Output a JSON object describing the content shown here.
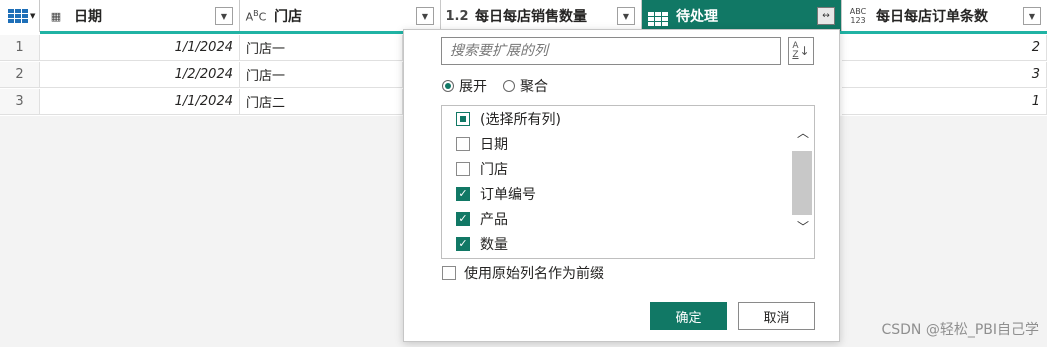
{
  "table": {
    "columns": [
      {
        "type_icon": "calendar-icon",
        "label": "日期"
      },
      {
        "type_icon": "ABC",
        "label": "门店"
      },
      {
        "type_icon": "1.2",
        "label": "每日每店销售数量"
      },
      {
        "type_icon": "table-icon",
        "label": "待处理"
      },
      {
        "type_icon": "ABC 123",
        "label": "每日每店订单条数"
      }
    ],
    "rows": [
      {
        "num": "1",
        "date": "1/1/2024",
        "store": "门店一",
        "orders": "2"
      },
      {
        "num": "2",
        "date": "1/2/2024",
        "store": "门店一",
        "orders": "3"
      },
      {
        "num": "3",
        "date": "1/1/2024",
        "store": "门店二",
        "orders": "1"
      }
    ]
  },
  "popup": {
    "search_placeholder": "搜索要扩展的列",
    "sort_top": "A",
    "sort_bottom": "Z",
    "radio_expand": "展开",
    "radio_aggregate": "聚合",
    "items": [
      {
        "label": "(选择所有列)",
        "state": "partial"
      },
      {
        "label": "日期",
        "state": "off"
      },
      {
        "label": "门店",
        "state": "off"
      },
      {
        "label": "订单编号",
        "state": "on"
      },
      {
        "label": "产品",
        "state": "on"
      },
      {
        "label": "数量",
        "state": "on"
      }
    ],
    "prefix_label": "使用原始列名作为前缀",
    "ok": "确定",
    "cancel": "取消"
  },
  "watermark": "CSDN @轻松_PBI自己学",
  "colors": {
    "accent": "#117865",
    "teal_line": "#20b3a4"
  }
}
